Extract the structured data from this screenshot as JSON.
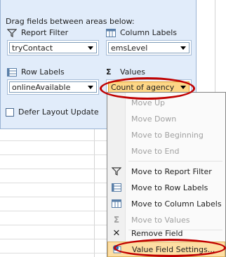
{
  "pane": {
    "title": "Drag fields between areas below:",
    "report_filter": {
      "label": "Report Filter",
      "field": "tryContact"
    },
    "column_labels": {
      "label": "Column Labels",
      "field": "emsLevel"
    },
    "row_labels": {
      "label": "Row Labels",
      "field": "onlineAvailable"
    },
    "values": {
      "label": "Values",
      "sigma": "Σ",
      "field": "Count of agency"
    },
    "defer_update": {
      "label": "Defer Layout Update",
      "checked": false
    }
  },
  "context_menu": {
    "items": [
      {
        "label": "Move Up",
        "enabled": false,
        "icon": ""
      },
      {
        "label": "Move Down",
        "enabled": false,
        "icon": ""
      },
      {
        "label": "Move to Beginning",
        "enabled": false,
        "icon": ""
      },
      {
        "label": "Move to End",
        "enabled": false,
        "icon": ""
      },
      {
        "label": "Move to Report Filter",
        "enabled": true,
        "icon": "filter-icon"
      },
      {
        "label": "Move to Row Labels",
        "enabled": true,
        "icon": "row-labels-icon"
      },
      {
        "label": "Move to Column Labels",
        "enabled": true,
        "icon": "column-labels-icon"
      },
      {
        "label": "Move to Values",
        "enabled": false,
        "icon": "sigma-icon",
        "glyph": "Σ"
      },
      {
        "label": "Remove Field",
        "enabled": true,
        "icon": "remove-icon",
        "glyph": "✕"
      },
      {
        "label": "Value Field Settings...",
        "enabled": true,
        "icon": "value-settings-icon",
        "highlighted": true
      }
    ]
  },
  "colors": {
    "pane_bg": "#e1ecfa",
    "active_field": "#fdd686",
    "menu_highlight": "#fddea3",
    "annotation": "#c00000"
  }
}
